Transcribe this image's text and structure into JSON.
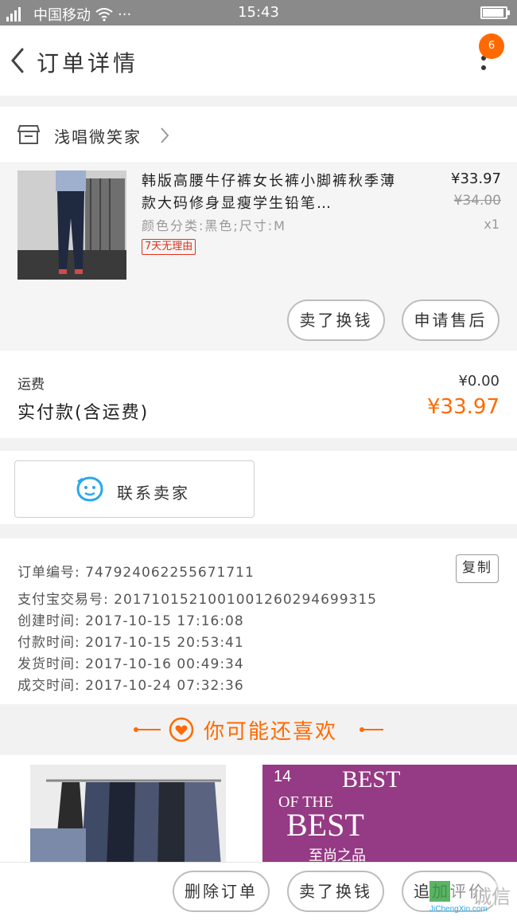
{
  "status_bar": {
    "carrier": "中国移动",
    "more": "···",
    "time": "15:43",
    "battery_level": 0.85
  },
  "header": {
    "title": "订单详情",
    "badge": "6"
  },
  "shop": {
    "name": "浅唱微笑家"
  },
  "product": {
    "title": "韩版高腰牛仔裤女长裤小脚裤秋季薄款大码修身显瘦学生铅笔…",
    "spec": "颜色分类:黑色;尺寸:M",
    "badge": "7天无理由",
    "price": "¥33.97",
    "original_price": "¥34.00",
    "quantity": "x1",
    "actions": {
      "refund": "卖了换钱",
      "after_sale": "申请售后"
    }
  },
  "payment": {
    "shipping_label": "运费",
    "shipping_value": "¥0.00",
    "total_label": "实付款(含运费)",
    "total_value": "¥33.97"
  },
  "contact": {
    "label": "联系卖家"
  },
  "order_info": {
    "order_no": "订单编号:  747924062255671711",
    "alipay_no": "支付宝交易号: 2017101521001001260294699315",
    "created": "创建时间: 2017-10-15 17:16:08",
    "paid": "付款时间: 2017-10-15 20:53:41",
    "shipped": "发货时间: 2017-10-16 00:49:34",
    "completed": "成交时间: 2017-10-24 07:32:36",
    "copy_label": "复制"
  },
  "recommend": {
    "title": "你可能还喜欢",
    "item2_badge": "14",
    "item2_line1": "BEST",
    "item2_line2": "OF THE",
    "item2_line3": "BEST",
    "item2_line4": "至尚之品"
  },
  "bottom_bar": {
    "delete": "删除订单",
    "sell": "卖了换钱",
    "review": "追加评价"
  },
  "watermark": {
    "brand": "诚信",
    "url": "JiChengXin.com"
  },
  "colors": {
    "accent": "#ff6a00",
    "badge_red": "#e0321a",
    "chat_blue": "#2aa8e8"
  }
}
